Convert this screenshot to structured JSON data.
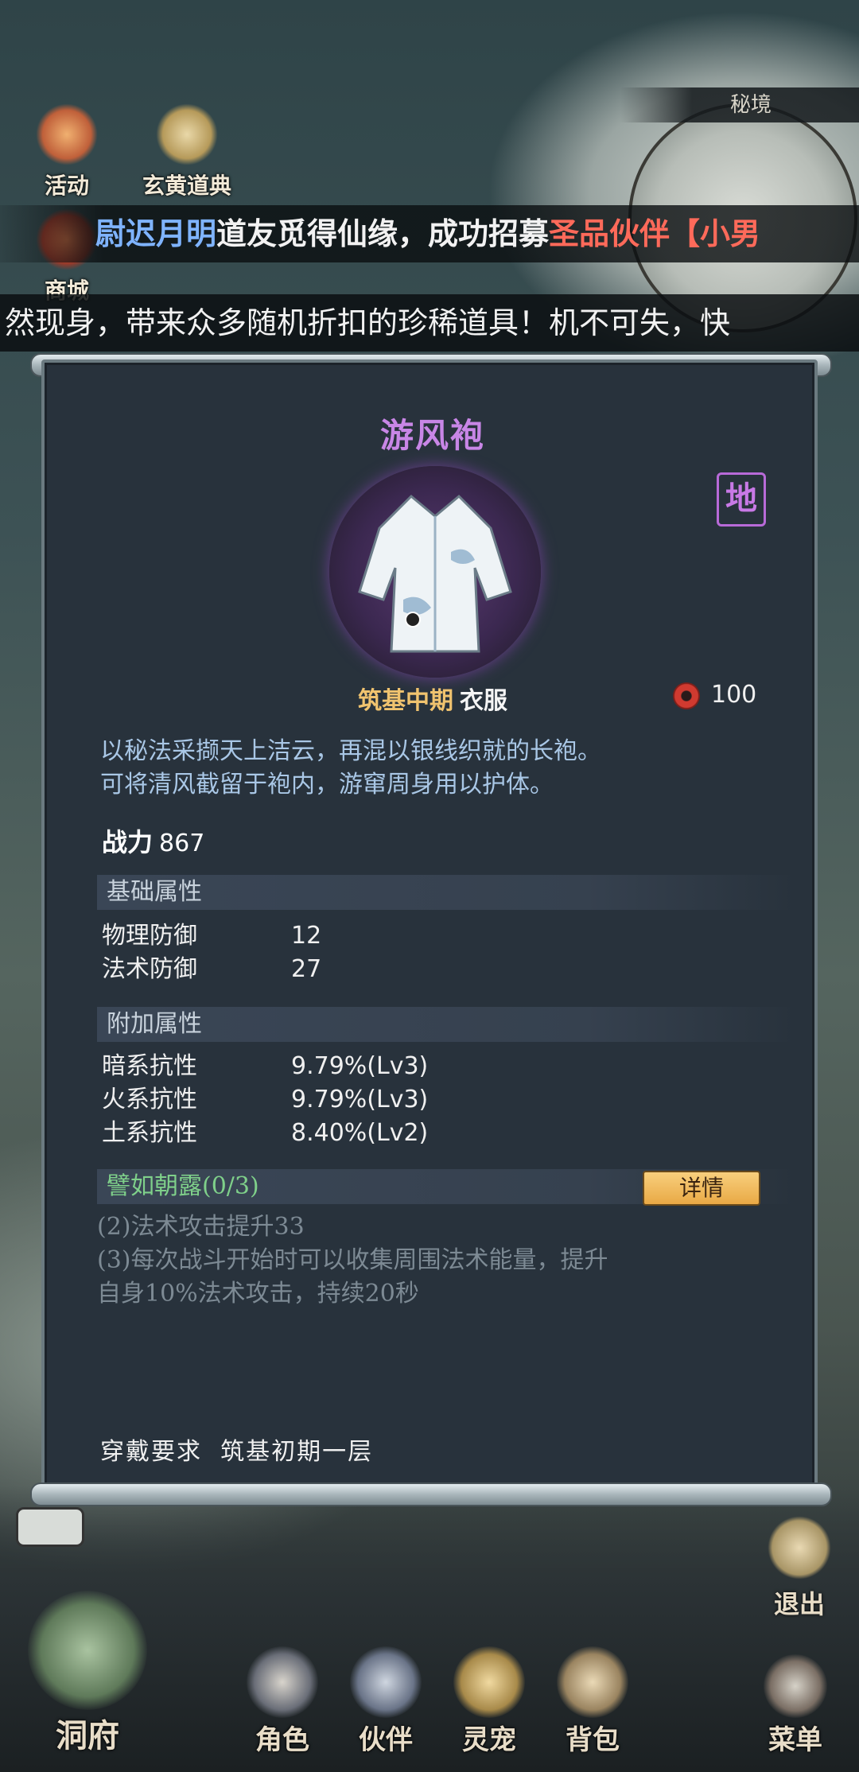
{
  "hud": {
    "activity_label": "活动",
    "codex_label": "玄黄道典",
    "shop_label": "商城",
    "map_label": "秘境"
  },
  "announcements": {
    "line1_player": "尉迟月明",
    "line1_text": "道友觅得仙缘，成功招募",
    "line1_highlight": "圣品伙伴【小男",
    "line2_text": "然现身，带来众多随机折扣的珍稀道具！机不可失，快"
  },
  "item": {
    "name": "游风袍",
    "grade_badge": "地",
    "realm": "筑基中期",
    "slot": "衣服",
    "score": "100",
    "description_line1": "以秘法采撷天上洁云，再混以银线织就的长袍。",
    "description_line2": "可将清风截留于袍内，游窜周身用以护体。",
    "power_label": "战力",
    "power_value": "867",
    "base_section": "基础属性",
    "base_attrs": [
      {
        "name": "物理防御",
        "value": "12"
      },
      {
        "name": "法术防御",
        "value": "27"
      }
    ],
    "extra_section": "附加属性",
    "extra_attrs": [
      {
        "name": "暗系抗性",
        "value": "9.79%(Lv3)"
      },
      {
        "name": "火系抗性",
        "value": "9.79%(Lv3)"
      },
      {
        "name": "土系抗性",
        "value": "8.40%(Lv2)"
      }
    ],
    "set_name": "譬如朝露(0/3)",
    "detail_button": "详情",
    "set_effect_1": "(2)法术攻击提升33",
    "set_effect_2": "(3)每次战斗开始时可以收集周围法术能量，提升",
    "set_effect_3": "自身10%法术攻击，持续20秒",
    "requirement_label": "穿戴要求",
    "requirement_value": "筑基初期一层"
  },
  "bottom_nav": {
    "cave": "洞府",
    "role": "角色",
    "partner": "伙伴",
    "pet": "灵宠",
    "bag": "背包",
    "menu": "菜单",
    "exit": "退出"
  },
  "colors": {
    "title_purple": "#c886e6",
    "realm_gold": "#f0c36f",
    "desc_blue": "#a9c7e6",
    "set_green": "#7fd08a",
    "player_blue": "#7fb4ff",
    "highlight_red": "#ff6a5a"
  }
}
